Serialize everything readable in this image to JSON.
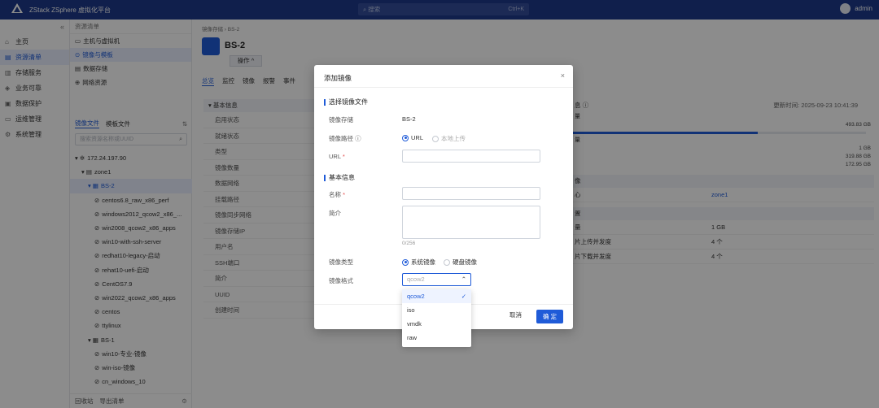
{
  "topbar": {
    "brand": "ZStack ZSphere 虚拟化平台",
    "logo_text": "ZStack",
    "search_placeholder": "搜索",
    "search_shortcut": "Ctrl+K",
    "user": "admin"
  },
  "nav": {
    "collapse": "«",
    "items": [
      {
        "label": "主页",
        "icon": "home-icon"
      },
      {
        "label": "资源清单",
        "icon": "list-icon",
        "active": true
      },
      {
        "label": "存储服务",
        "icon": "storage-icon"
      },
      {
        "label": "业务可靠",
        "icon": "shield-icon"
      },
      {
        "label": "数据保护",
        "icon": "lock-icon"
      },
      {
        "label": "运维管理",
        "icon": "monitor-icon"
      },
      {
        "label": "系统管理",
        "icon": "gear-icon"
      }
    ]
  },
  "respanel": {
    "title": "资源清单",
    "items": [
      {
        "label": "主机与虚拟机"
      },
      {
        "label": "镜像与模板",
        "active": true
      },
      {
        "label": "数据存储"
      },
      {
        "label": "网络资源"
      }
    ],
    "tabs": [
      "镜像文件",
      "模板文件"
    ],
    "search_placeholder": "搜索资源名称或UUID",
    "tree": [
      {
        "label": "172.24.197.90",
        "level": 0,
        "prefix": "▾ ✲"
      },
      {
        "label": "zone1",
        "level": 1,
        "prefix": "▾ ▤"
      },
      {
        "label": "BS-2",
        "level": 2,
        "prefix": "▾ ▦",
        "selected": true
      },
      {
        "label": "centos6.8_raw_x86_perf",
        "level": 3,
        "prefix": "⊘"
      },
      {
        "label": "windows2012_qcow2_x86_...",
        "level": 3,
        "prefix": "⊘"
      },
      {
        "label": "win2008_qcow2_x86_apps",
        "level": 3,
        "prefix": "⊘"
      },
      {
        "label": "win10-with-ssh-server",
        "level": 3,
        "prefix": "⊘"
      },
      {
        "label": "redhat10-legacy-启动",
        "level": 3,
        "prefix": "⊘"
      },
      {
        "label": "rehat10-uefi-启动",
        "level": 3,
        "prefix": "⊘"
      },
      {
        "label": "CentOS7.9",
        "level": 3,
        "prefix": "⊘"
      },
      {
        "label": "win2022_qcow2_x86_apps",
        "level": 3,
        "prefix": "⊘"
      },
      {
        "label": "centos",
        "level": 3,
        "prefix": "⊘"
      },
      {
        "label": "ttylinux",
        "level": 3,
        "prefix": "⊘"
      },
      {
        "label": "BS-1",
        "level": 2,
        "prefix": "▾ ▦"
      },
      {
        "label": "win10-专业-镜像",
        "level": 3,
        "prefix": "⊘"
      },
      {
        "label": "win-iso-镜像",
        "level": 3,
        "prefix": "⊘"
      },
      {
        "label": "cn_windows_10",
        "level": 3,
        "prefix": "⊘"
      }
    ],
    "footer": {
      "recycle": "回收站",
      "export": "导出清单"
    }
  },
  "main": {
    "breadcrumb": "镜像存储 › BS-2",
    "title": "BS-2",
    "ops_button": "操作 ^",
    "tabs": [
      "总览",
      "监控",
      "镜像",
      "报警",
      "事件"
    ],
    "basic_info_header": "▾ 基本信息",
    "basic_rows": [
      "启用状态",
      "就绪状态",
      "类型",
      "镜像数量",
      "数据网络",
      "挂载路径",
      "镜像同步网络",
      "镜像存储IP",
      "用户名",
      "SSH端口",
      "简介",
      "UUID",
      "创建时间"
    ],
    "capacity": {
      "label": "息 ⓘ",
      "updated": "更新时间: 2025-09-23 10:41:39",
      "line1": "量",
      "total": "493.83 GB",
      "fill_fraction": 0.63,
      "line2": "量",
      "vals": [
        "1 GB",
        "319.88 GB",
        "172.95 GB"
      ]
    },
    "zone_section": "像",
    "zone_row": {
      "k": "心",
      "v": "zone1"
    },
    "config_section": "置",
    "config_rows": [
      {
        "k": "量",
        "v": "1 GB"
      },
      {
        "k": "片上传并发度",
        "v": "4 个"
      },
      {
        "k": "片下载并发度",
        "v": "4 个"
      }
    ]
  },
  "modal": {
    "title": "添加镜像",
    "close": "×",
    "section1": "选择镜像文件",
    "storage_label": "镜像存储",
    "storage_value": "BS-2",
    "path_label": "镜像路径 ⓘ",
    "path_options": [
      "URL",
      "本地上传"
    ],
    "url_label": "URL",
    "required_mark": "*",
    "section2": "基本信息",
    "name_label": "名称",
    "desc_label": "简介",
    "desc_count": "0/256",
    "type_label": "镜像类型",
    "type_options": [
      "系统镜像",
      "硬盘镜像"
    ],
    "format_label": "镜像格式",
    "format_value": "qcow2",
    "cancel": "取消",
    "confirm": "确 定"
  },
  "dropdown": {
    "options": [
      "qcow2",
      "iso",
      "vmdk",
      "raw"
    ],
    "selected": "qcow2",
    "check": "✓"
  },
  "colors": {
    "primary": "#1f5bd8",
    "topbar": "#1e3a8a",
    "required": "#e34a4a"
  }
}
